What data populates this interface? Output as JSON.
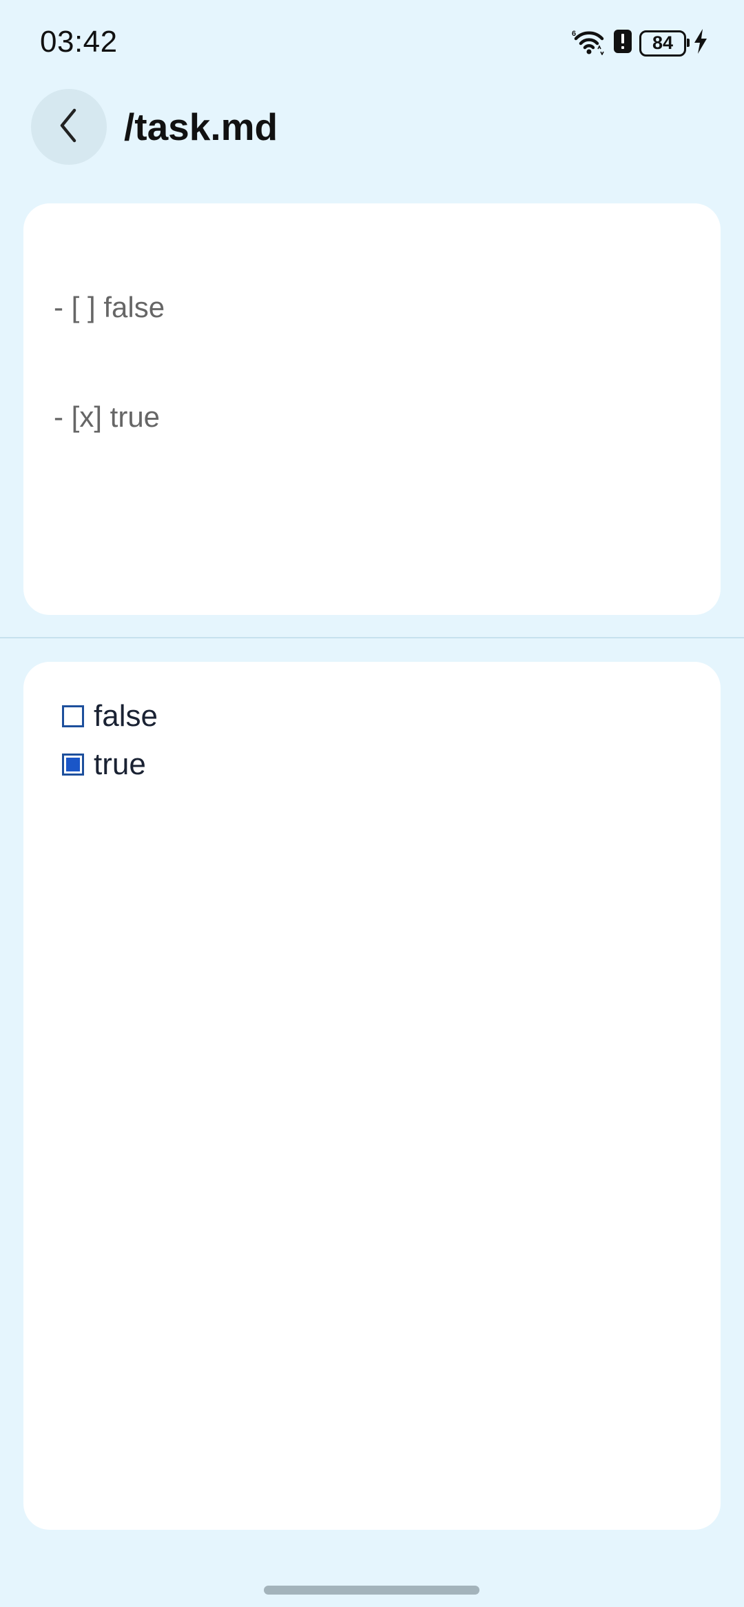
{
  "status_bar": {
    "time": "03:42",
    "battery_level": "84",
    "icons": [
      "wifi-icon",
      "alert-icon",
      "battery-icon",
      "charging-icon"
    ]
  },
  "header": {
    "back_icon": "chevron-left-icon",
    "title": "/task.md"
  },
  "editor": {
    "lines": [
      "- [ ] false",
      "- [x] true"
    ]
  },
  "preview": {
    "tasks": [
      {
        "label": "false",
        "checked": false
      },
      {
        "label": "true",
        "checked": true
      }
    ]
  },
  "colors": {
    "background": "#e5f5fd",
    "card": "#ffffff",
    "checkbox_accent": "#1a56c8",
    "editor_text": "#666666"
  }
}
